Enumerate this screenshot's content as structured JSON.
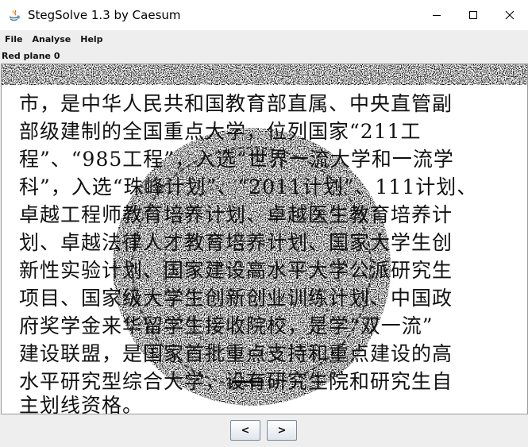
{
  "window": {
    "title": "StegSolve 1.3 by Caesum"
  },
  "menu": {
    "items": [
      "File",
      "Analyse",
      "Help"
    ]
  },
  "view": {
    "plane_label": "Red plane 0",
    "document_lines": [
      "市，是中华人民共和国教育部直属、中央直管副",
      "部级建制的全国重点大学，位列国家“211工",
      "程”、“985工程”，入选“世界一流大学和一流学",
      "科”，入选“珠峰计划”、“2011计划”、111计划、",
      "卓越工程师教育培养计划、卓越医生教育培养计",
      "划、卓越法律人才教育培养计划、国家大学生创",
      "新性实验计划、国家建设高水平大学公派研究生",
      "项目、国家级大学生创新创业训练计划、中国政",
      "府奖学金来华留学生接收院校，是学“双一流”",
      "建设联盟，是国家首批重点支持和重点建设的高",
      "水平研究型综合大学，设有研究生院和研究生自",
      "主划线资格。"
    ]
  },
  "navigation": {
    "prev_label": "<",
    "next_label": ">"
  }
}
